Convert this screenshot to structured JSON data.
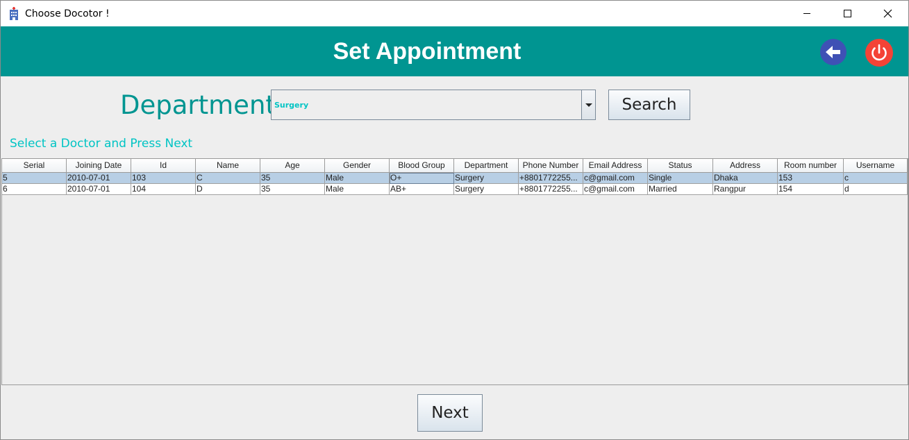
{
  "window": {
    "title": "Choose Docotor !"
  },
  "header": {
    "title": "Set Appointment"
  },
  "department": {
    "label": "Department",
    "selected": "Surgery",
    "search_label": "Search"
  },
  "hint": "Select a Doctor and Press Next",
  "table": {
    "columns": [
      "Serial",
      "Joining Date",
      "Id",
      "Name",
      "Age",
      "Gender",
      "Blood Group",
      "Department",
      "Phone Number",
      "Email Address",
      "Status",
      "Address",
      "Room number",
      "Username"
    ],
    "rows": [
      [
        "5",
        "2010-07-01",
        "103",
        "C",
        "35",
        "Male",
        "O+",
        "Surgery",
        "+8801772255...",
        "c@gmail.com",
        "Single",
        "Dhaka",
        "153",
        "c"
      ],
      [
        "6",
        "2010-07-01",
        "104",
        "D",
        "35",
        "Male",
        "AB+",
        "Surgery",
        "+8801772255...",
        "c@gmail.com",
        "Married",
        "Rangpur",
        "154",
        "d"
      ]
    ],
    "selected_row": 0
  },
  "footer": {
    "next_label": "Next"
  },
  "colors": {
    "header": "#009591",
    "accent_text": "#00c4c4",
    "back_button": "#3f51b5",
    "power_button": "#f44336",
    "selected_row": "#b8cfe5"
  }
}
